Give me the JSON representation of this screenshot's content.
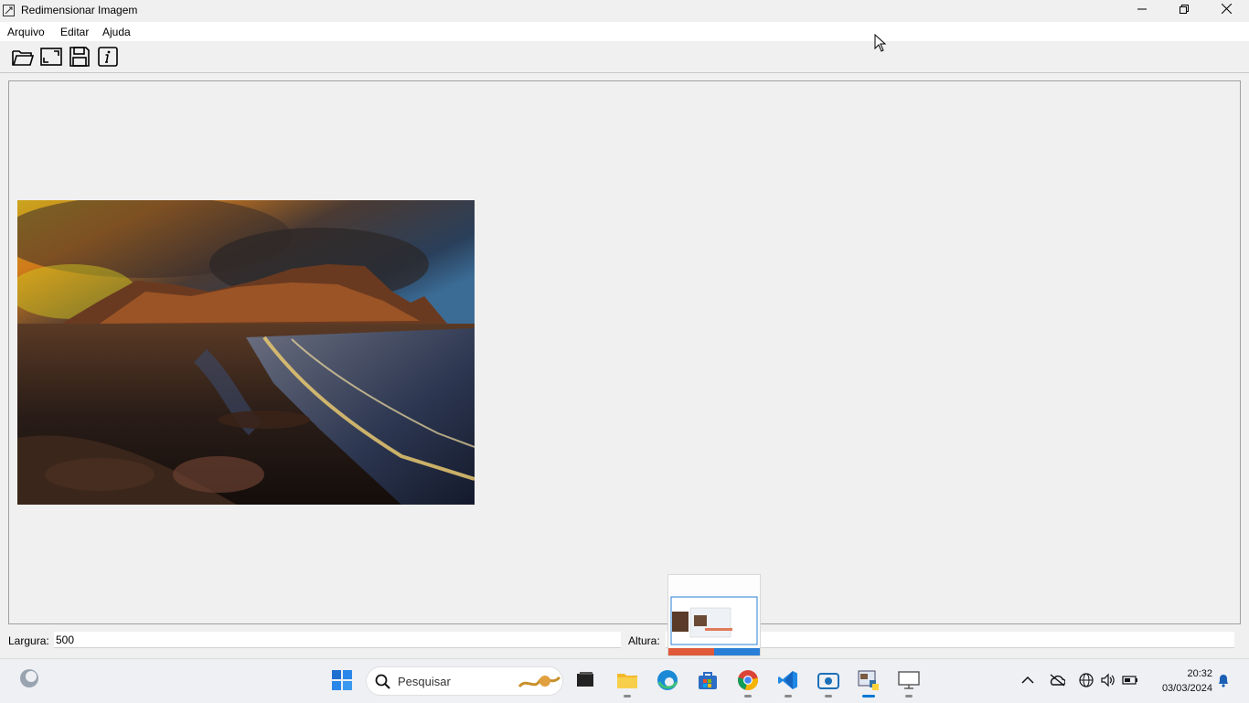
{
  "window": {
    "title": "Redimensionar Imagem",
    "icon": "resize-image-app-icon",
    "controls": [
      "minimize-icon",
      "restore-icon",
      "close-icon"
    ]
  },
  "menu": {
    "items": [
      {
        "label": "Arquivo"
      },
      {
        "label": "Editar"
      },
      {
        "label": "Ajuda"
      }
    ]
  },
  "toolbar": {
    "buttons": [
      "open-folder-icon",
      "resize-icon",
      "save-icon",
      "info-icon"
    ]
  },
  "canvas": {
    "image": "landscape-photo"
  },
  "fields": {
    "width_label": "Largura:",
    "width_value": "500",
    "height_label": "Altura:",
    "height_value": ""
  },
  "taskbar": {
    "search_placeholder": "Pesquisar",
    "time": "20:32",
    "date": "03/03/2024",
    "apps": [
      "start-icon",
      "search-icon",
      "widgets-icon",
      "task-view-icon",
      "file-explorer-icon",
      "edge-icon",
      "store-icon",
      "chrome-icon",
      "vscode-icon",
      "camera-app-icon",
      "python-app-icon",
      "remote-desktop-icon"
    ],
    "tray": [
      "chevron-up-icon",
      "onedrive-icon",
      "network-icon",
      "volume-icon",
      "battery-icon",
      "notification-bell-icon"
    ]
  },
  "colors": {
    "accent": "#0078d4",
    "taskbar_bg": "#eef0f4",
    "window_bg": "#f0f0f0"
  }
}
